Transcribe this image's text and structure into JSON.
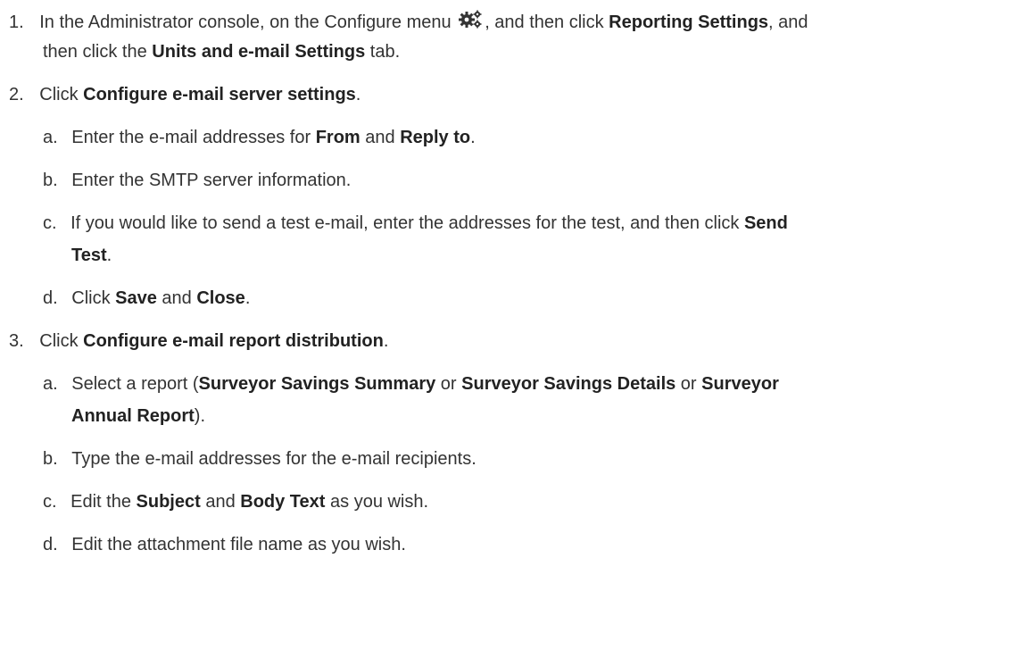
{
  "steps": [
    {
      "number": "1.",
      "text": {
        "p1": "In the Administrator console, on the Configure menu ",
        "p2": ", and then click ",
        "b1": "Reporting Settings",
        "p3": ", and",
        "p4": "then click the ",
        "b2": "Units and e-mail Settings",
        "p5": " tab."
      },
      "icon": "gears-icon"
    },
    {
      "number": "2.",
      "text": {
        "p1": "Click ",
        "b1": "Configure e-mail server settings",
        "p2": "."
      },
      "substeps": [
        {
          "letter": "a.",
          "p1": "Enter the e-mail addresses for ",
          "b1": "From",
          "p2": " and ",
          "b2": "Reply to",
          "p3": "."
        },
        {
          "letter": "b.",
          "p1": "Enter the SMTP server information."
        },
        {
          "letter": "c.",
          "p1": "If you would like to send a test e-mail, enter the addresses for the test, and then click ",
          "b1": "Send",
          "b2": "Test",
          "p2": "."
        },
        {
          "letter": "d.",
          "p1": "Click ",
          "b1": "Save",
          "p2": " and ",
          "b2": "Close",
          "p3": "."
        }
      ]
    },
    {
      "number": "3.",
      "text": {
        "p1": "Click ",
        "b1": "Configure e-mail report distribution",
        "p2": "."
      },
      "substeps": [
        {
          "letter": "a.",
          "p1": "Select a report (",
          "b1": "Surveyor Savings Summary",
          "p2": " or ",
          "b2": "Surveyor Savings Details",
          "p3": " or ",
          "b3": "Surveyor",
          "b4": "Annual Report",
          "p4": ")."
        },
        {
          "letter": "b.",
          "p1": "Type the e-mail addresses for the e-mail recipients."
        },
        {
          "letter": "c.",
          "p1": "Edit the ",
          "b1": "Subject",
          "p2": " and ",
          "b2": "Body Text",
          "p3": " as you wish."
        },
        {
          "letter": "d.",
          "p1": "Edit the attachment file name as you wish."
        }
      ]
    }
  ]
}
